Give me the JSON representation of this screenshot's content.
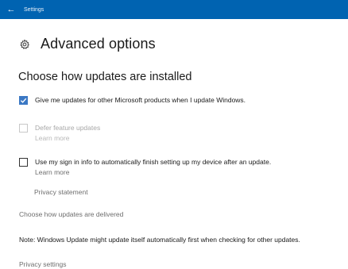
{
  "window": {
    "back_glyph": "←",
    "title": "Settings"
  },
  "header": {
    "icon": "gear-icon",
    "title": "Advanced options"
  },
  "section": {
    "title": "Choose how updates are installed"
  },
  "options": {
    "microsoft_updates": {
      "label": "Give me updates for other Microsoft products when I update Windows.",
      "checked": true
    },
    "defer_feature": {
      "label": "Defer feature updates",
      "learn_more": "Learn more",
      "checked": false,
      "disabled": true
    },
    "sign_in_info": {
      "label": "Use my sign in info to automatically finish setting up my device after an update.",
      "learn_more": "Learn more",
      "checked": false
    }
  },
  "links": {
    "privacy_statement": "Privacy statement",
    "delivery": "Choose how updates are delivered",
    "privacy_settings": "Privacy settings"
  },
  "note": "Note: Windows Update might update itself automatically first when checking for other updates.",
  "colors": {
    "accent": "#0063b1",
    "checkbox_checked": "#3b78c4"
  }
}
